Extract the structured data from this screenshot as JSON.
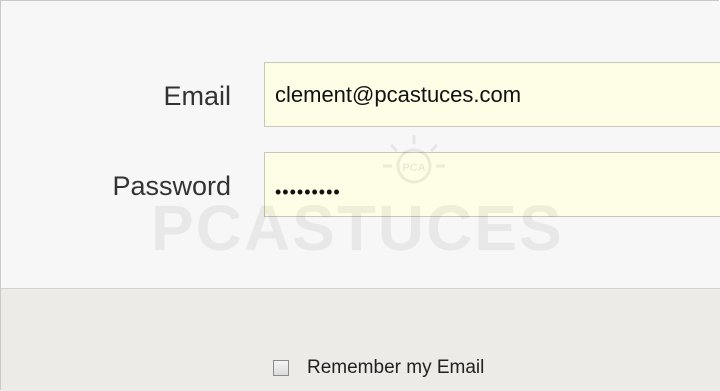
{
  "form": {
    "email_label": "Email",
    "email_value": "clement@pcastuces.com",
    "password_label": "Password",
    "password_masked": "•••••••••",
    "remember_label": "Remember my Email",
    "remember_checked": false
  },
  "watermark": {
    "text": "PCASTUCES",
    "icon": "lightbulb-icon"
  },
  "colors": {
    "field_bg": "#fefde6",
    "panel_bg": "#f7f7f7",
    "footer_bg": "#ecebe8"
  }
}
